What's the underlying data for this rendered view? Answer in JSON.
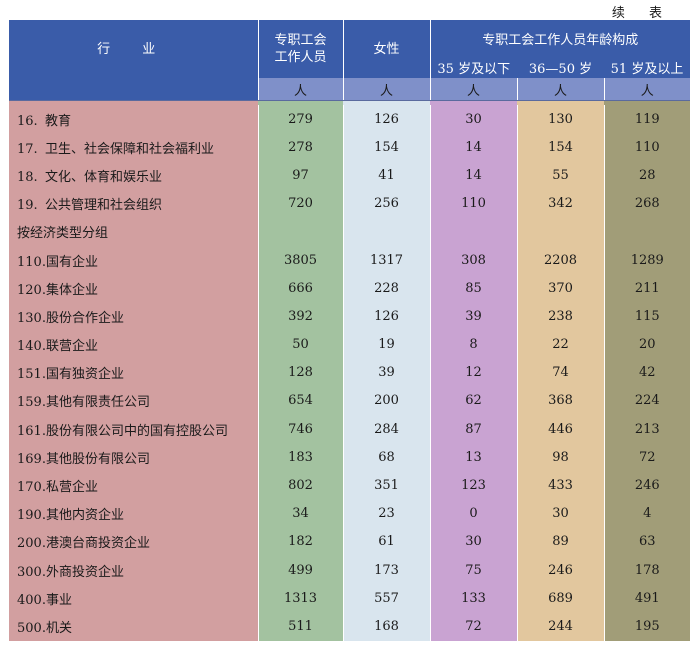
{
  "continued_label": "续 表",
  "header": {
    "row_header": "行 业",
    "col_union_staff": "专职工会工作人员",
    "col_female": "女性",
    "age_group_title": "专职工会工作人员年龄构成",
    "age_groups": [
      "35 岁及以下",
      "36—50 岁",
      "51 岁及以上"
    ],
    "unit": "人"
  },
  "rows": [
    {
      "code": "16.",
      "name": "教育",
      "values": [
        "279",
        "126",
        "30",
        "130",
        "119"
      ]
    },
    {
      "code": "17.",
      "name": "卫生、社会保障和社会福利业",
      "values": [
        "278",
        "154",
        "14",
        "154",
        "110"
      ]
    },
    {
      "code": "18.",
      "name": "文化、体育和娱乐业",
      "values": [
        "97",
        "41",
        "14",
        "55",
        "28"
      ]
    },
    {
      "code": "19.",
      "name": "公共管理和社会组织",
      "values": [
        "720",
        "256",
        "110",
        "342",
        "268"
      ]
    },
    {
      "code": "",
      "name": "按经济类型分组",
      "values": [
        "",
        "",
        "",
        "",
        ""
      ]
    },
    {
      "code": "110.",
      "name": "国有企业",
      "values": [
        "3805",
        "1317",
        "308",
        "2208",
        "1289"
      ]
    },
    {
      "code": "120.",
      "name": "集体企业",
      "values": [
        "666",
        "228",
        "85",
        "370",
        "211"
      ]
    },
    {
      "code": "130.",
      "name": "股份合作企业",
      "values": [
        "392",
        "126",
        "39",
        "238",
        "115"
      ]
    },
    {
      "code": "140.",
      "name": "联营企业",
      "values": [
        "50",
        "19",
        "8",
        "22",
        "20"
      ]
    },
    {
      "code": "151.",
      "name": "国有独资企业",
      "values": [
        "128",
        "39",
        "12",
        "74",
        "42"
      ]
    },
    {
      "code": "159.",
      "name": "其他有限责任公司",
      "values": [
        "654",
        "200",
        "62",
        "368",
        "224"
      ]
    },
    {
      "code": "161.",
      "name": "股份有限公司中的国有控股公司",
      "values": [
        "746",
        "284",
        "87",
        "446",
        "213"
      ]
    },
    {
      "code": "169.",
      "name": "其他股份有限公司",
      "values": [
        "183",
        "68",
        "13",
        "98",
        "72"
      ]
    },
    {
      "code": "170.",
      "name": "私营企业",
      "values": [
        "802",
        "351",
        "123",
        "433",
        "246"
      ]
    },
    {
      "code": "190.",
      "name": "其他内资企业",
      "values": [
        "34",
        "23",
        "0",
        "30",
        "4"
      ]
    },
    {
      "code": "200.",
      "name": "港澳台商投资企业",
      "values": [
        "182",
        "61",
        "30",
        "89",
        "63"
      ]
    },
    {
      "code": "300.",
      "name": "外商投资企业",
      "values": [
        "499",
        "173",
        "75",
        "246",
        "178"
      ]
    },
    {
      "code": "400.",
      "name": "事业",
      "values": [
        "1313",
        "557",
        "133",
        "689",
        "491"
      ]
    },
    {
      "code": "500.",
      "name": "机关",
      "values": [
        "511",
        "168",
        "72",
        "244",
        "195"
      ]
    }
  ]
}
